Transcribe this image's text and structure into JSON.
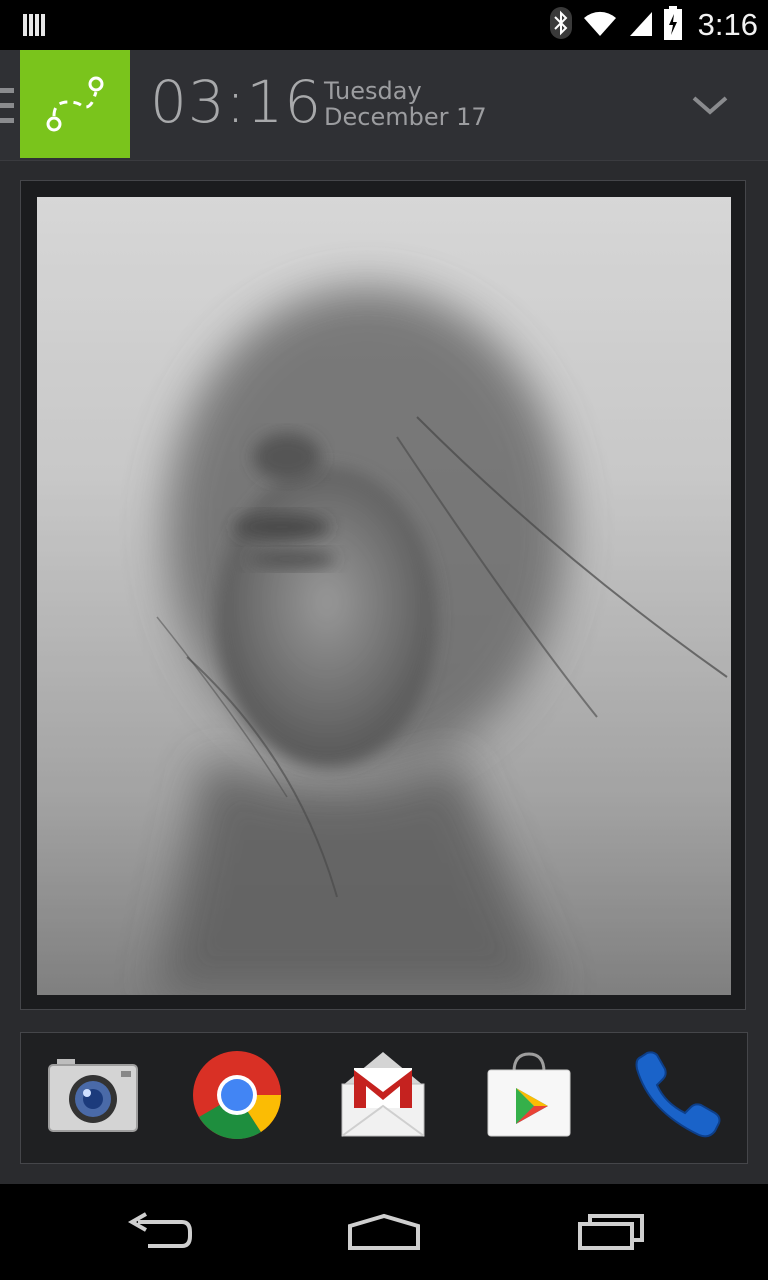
{
  "status_bar": {
    "time": "3:16",
    "icons": [
      "signal-bars-icon",
      "bluetooth-icon",
      "wifi-icon",
      "cell-signal-icon",
      "battery-charging-icon"
    ]
  },
  "header": {
    "app_icon": "route-path-icon",
    "clock": "03:16",
    "day": "Tuesday",
    "date": "December 17",
    "expand_icon": "chevron-down-icon",
    "accent_color": "#7ac41c"
  },
  "widget": {
    "photo_icon": "foggy-portrait-photo"
  },
  "dock": {
    "apps": [
      {
        "name": "Camera",
        "icon": "camera-icon"
      },
      {
        "name": "Chrome",
        "icon": "chrome-icon"
      },
      {
        "name": "Gmail",
        "icon": "gmail-icon"
      },
      {
        "name": "Play Store",
        "icon": "play-store-icon"
      },
      {
        "name": "Phone",
        "icon": "phone-icon"
      }
    ]
  },
  "navigation": {
    "buttons": [
      "back-icon",
      "home-icon",
      "recents-icon"
    ]
  }
}
